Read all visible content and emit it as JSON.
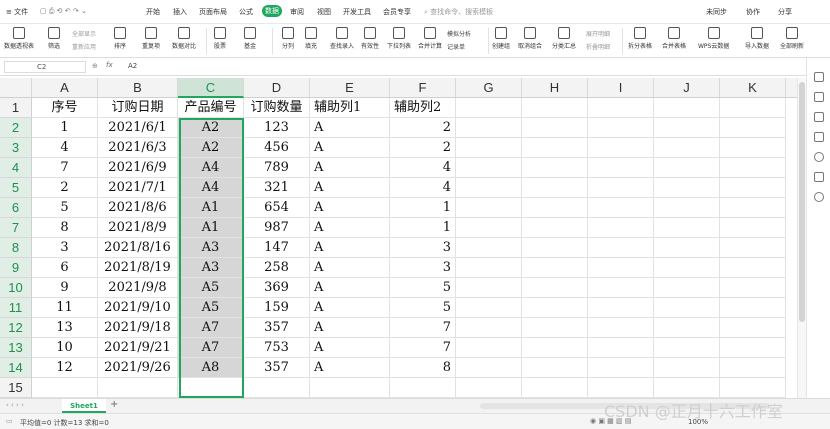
{
  "menubar": {
    "file": "≡ 文件",
    "tabs": [
      "开始",
      "插入",
      "页面布局",
      "公式",
      "数据",
      "审阅",
      "视图",
      "开发工具",
      "会员专享"
    ],
    "active_tab": "数据",
    "search_placeholder": "查找命令、搜索模板",
    "right": [
      "未同步",
      "协作",
      "分享"
    ]
  },
  "ribbon": {
    "buttons": [
      "数据透视表",
      "筛选",
      "排序",
      "重复项",
      "数据对比",
      "股票",
      "基金",
      "分列",
      "填充",
      "查找录入",
      "有效性",
      "下拉列表",
      "合并计算",
      "记录单",
      "创建组",
      "取消组合",
      "分类汇总",
      "拆分表格",
      "合并表格",
      "WPS云数据",
      "导入数据",
      "全部刷新"
    ],
    "small": [
      "全部显示",
      "重新应用",
      "模拟分析",
      "展开明细",
      "折叠明细"
    ]
  },
  "formula": {
    "name_box": "C2",
    "fx": "fx",
    "value": "A2"
  },
  "columns": [
    "A",
    "B",
    "C",
    "D",
    "E",
    "F",
    "G",
    "H",
    "I",
    "J",
    "K"
  ],
  "selected_column": "C",
  "headers": [
    "序号",
    "订购日期",
    "产品编号",
    "订购数量",
    "辅助列1",
    "辅助列2"
  ],
  "rows": [
    [
      "1",
      "2021/6/1",
      "A2",
      "123",
      "A",
      "2"
    ],
    [
      "4",
      "2021/6/3",
      "A2",
      "456",
      "A",
      "2"
    ],
    [
      "7",
      "2021/6/9",
      "A4",
      "789",
      "A",
      "4"
    ],
    [
      "2",
      "2021/7/1",
      "A4",
      "321",
      "A",
      "4"
    ],
    [
      "5",
      "2021/8/6",
      "A1",
      "654",
      "A",
      "1"
    ],
    [
      "8",
      "2021/8/9",
      "A1",
      "987",
      "A",
      "1"
    ],
    [
      "3",
      "2021/8/16",
      "A3",
      "147",
      "A",
      "3"
    ],
    [
      "6",
      "2021/8/19",
      "A3",
      "258",
      "A",
      "3"
    ],
    [
      "9",
      "2021/9/8",
      "A5",
      "369",
      "A",
      "5"
    ],
    [
      "11",
      "2021/9/10",
      "A5",
      "159",
      "A",
      "5"
    ],
    [
      "13",
      "2021/9/18",
      "A7",
      "357",
      "A",
      "7"
    ],
    [
      "10",
      "2021/9/21",
      "A7",
      "753",
      "A",
      "7"
    ],
    [
      "12",
      "2021/9/26",
      "A8",
      "357",
      "A",
      "8"
    ]
  ],
  "row_numbers": [
    "1",
    "2",
    "3",
    "4",
    "5",
    "6",
    "7",
    "8",
    "9",
    "10",
    "11",
    "12",
    "13",
    "14",
    "15"
  ],
  "sheet_tab": "Sheet1",
  "add_sheet": "+",
  "status": {
    "text": "平均值=0  计数=13  求和=0",
    "zoom": "100%"
  },
  "watermark": "CSDN @正月十六工作室",
  "colors": {
    "accent": "#1fa85d",
    "highlight": "#d6d6d6"
  }
}
